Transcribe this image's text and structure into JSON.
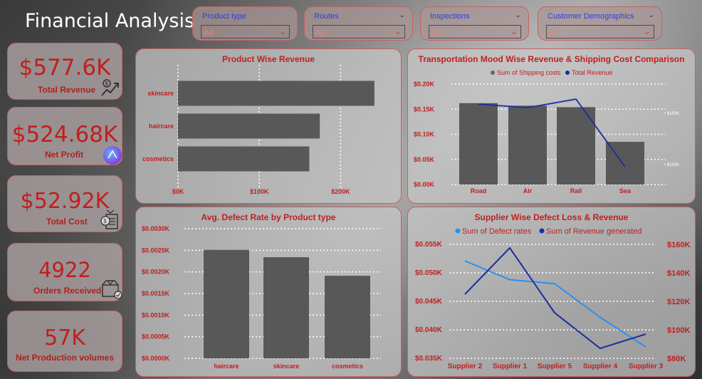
{
  "header": {
    "title": "Financial Analysis"
  },
  "filters": [
    {
      "label": "Product type",
      "value": "All"
    },
    {
      "label": "Routes",
      "value": "All"
    },
    {
      "label": "Inspections",
      "value": "All"
    },
    {
      "label": "Customer Demographics",
      "value": "All"
    }
  ],
  "kpis": [
    {
      "value": "$577.6K",
      "label": "Total Revenue",
      "icon": "revenue-growth-icon"
    },
    {
      "value": "$524.68K",
      "label": "Net Profit",
      "icon": "profit-badge-icon"
    },
    {
      "value": "$52.92K",
      "label": "Total Cost",
      "icon": "cost-bill-icon"
    },
    {
      "value": "4922",
      "label": "Orders Received",
      "icon": "order-box-icon"
    },
    {
      "value": "57K",
      "label": "Net Production volumes",
      "icon": ""
    }
  ],
  "colors": {
    "accent": "#c01f1f",
    "bar": "#585858",
    "line_dark": "#1c2ea0",
    "line_light": "#2f8ff0"
  },
  "chart_data": [
    {
      "type": "bar",
      "orientation": "horizontal",
      "title": "Product Wise Revenue",
      "categories": [
        "skincare",
        "haircare",
        "cosmetics"
      ],
      "values": [
        241628,
        174455,
        161521
      ],
      "xlim": [
        0,
        240000
      ],
      "xticks": [
        {
          "v": 0,
          "label": "$0K"
        },
        {
          "v": 100000,
          "label": "$100K"
        },
        {
          "v": 200000,
          "label": "$200K"
        }
      ],
      "grid": true
    },
    {
      "type": "bar",
      "title": "Transportation Mood Wise Revenue & Shipping Cost Comparison",
      "categories": [
        "Road",
        "Air",
        "Rail",
        "Sea"
      ],
      "series": [
        {
          "name": "Sum of Shipping costs",
          "kind": "bar",
          "values": [
            0.162,
            0.157,
            0.154,
            0.085
          ]
        },
        {
          "name": "Total Revenue",
          "kind": "line",
          "values": [
            0.16,
            0.153,
            0.17,
            0.035
          ]
        }
      ],
      "ylim": [
        0,
        0.2
      ],
      "yticks": [
        {
          "v": 0,
          "label": "$0.00K"
        },
        {
          "v": 0.05,
          "label": "$0.05K"
        },
        {
          "v": 0.1,
          "label": "$0.10K"
        },
        {
          "v": 0.15,
          "label": "$0.15K"
        },
        {
          "v": 0.2,
          "label": "$0.20K"
        }
      ],
      "y2ticks": [
        {
          "v": 0.143,
          "label": "$150K"
        },
        {
          "v": 0.041,
          "label": "$100K"
        }
      ],
      "grid": true,
      "legend": "top"
    },
    {
      "type": "bar",
      "title": "Avg. Defect Rate by Product type",
      "categories": [
        "haircare",
        "skincare",
        "cosmetics"
      ],
      "values": [
        0.00251,
        0.00234,
        0.00191
      ],
      "ylim": [
        0,
        0.003
      ],
      "yticks": [
        {
          "v": 0,
          "label": "$0.0000K"
        },
        {
          "v": 0.0005,
          "label": "$0.0005K"
        },
        {
          "v": 0.001,
          "label": "$0.0010K"
        },
        {
          "v": 0.0015,
          "label": "$0.0015K"
        },
        {
          "v": 0.002,
          "label": "$0.0020K"
        },
        {
          "v": 0.0025,
          "label": "$0.0025K"
        },
        {
          "v": 0.003,
          "label": "$0.0030K"
        }
      ],
      "grid": true
    },
    {
      "type": "line",
      "title": "Supplier Wise Defect Loss & Revenue",
      "categories": [
        "Supplier 2",
        "Supplier 1",
        "Supplier 5",
        "Supplier 4",
        "Supplier 3"
      ],
      "series": [
        {
          "name": "Sum of Defect rates",
          "axis": "left",
          "values": [
            0.0521,
            0.0488,
            0.0481,
            0.0422,
            0.037
          ]
        },
        {
          "name": "Sum of Revenue generated",
          "axis": "right",
          "values": [
            125000,
            157500,
            112000,
            87000,
            97000
          ]
        }
      ],
      "ylim": [
        0.035,
        0.055
      ],
      "y2lim": [
        80000,
        160000
      ],
      "yticks": [
        {
          "v": 0.035,
          "label": "$0.035K"
        },
        {
          "v": 0.04,
          "label": "$0.040K"
        },
        {
          "v": 0.045,
          "label": "$0.045K"
        },
        {
          "v": 0.05,
          "label": "$0.050K"
        },
        {
          "v": 0.055,
          "label": "$0.055K"
        }
      ],
      "y2ticks": [
        {
          "v": 80000,
          "label": "$80K"
        },
        {
          "v": 100000,
          "label": "$100K"
        },
        {
          "v": 120000,
          "label": "$120K"
        },
        {
          "v": 140000,
          "label": "$140K"
        },
        {
          "v": 160000,
          "label": "$160K"
        }
      ],
      "grid": true,
      "legend": "top"
    }
  ]
}
